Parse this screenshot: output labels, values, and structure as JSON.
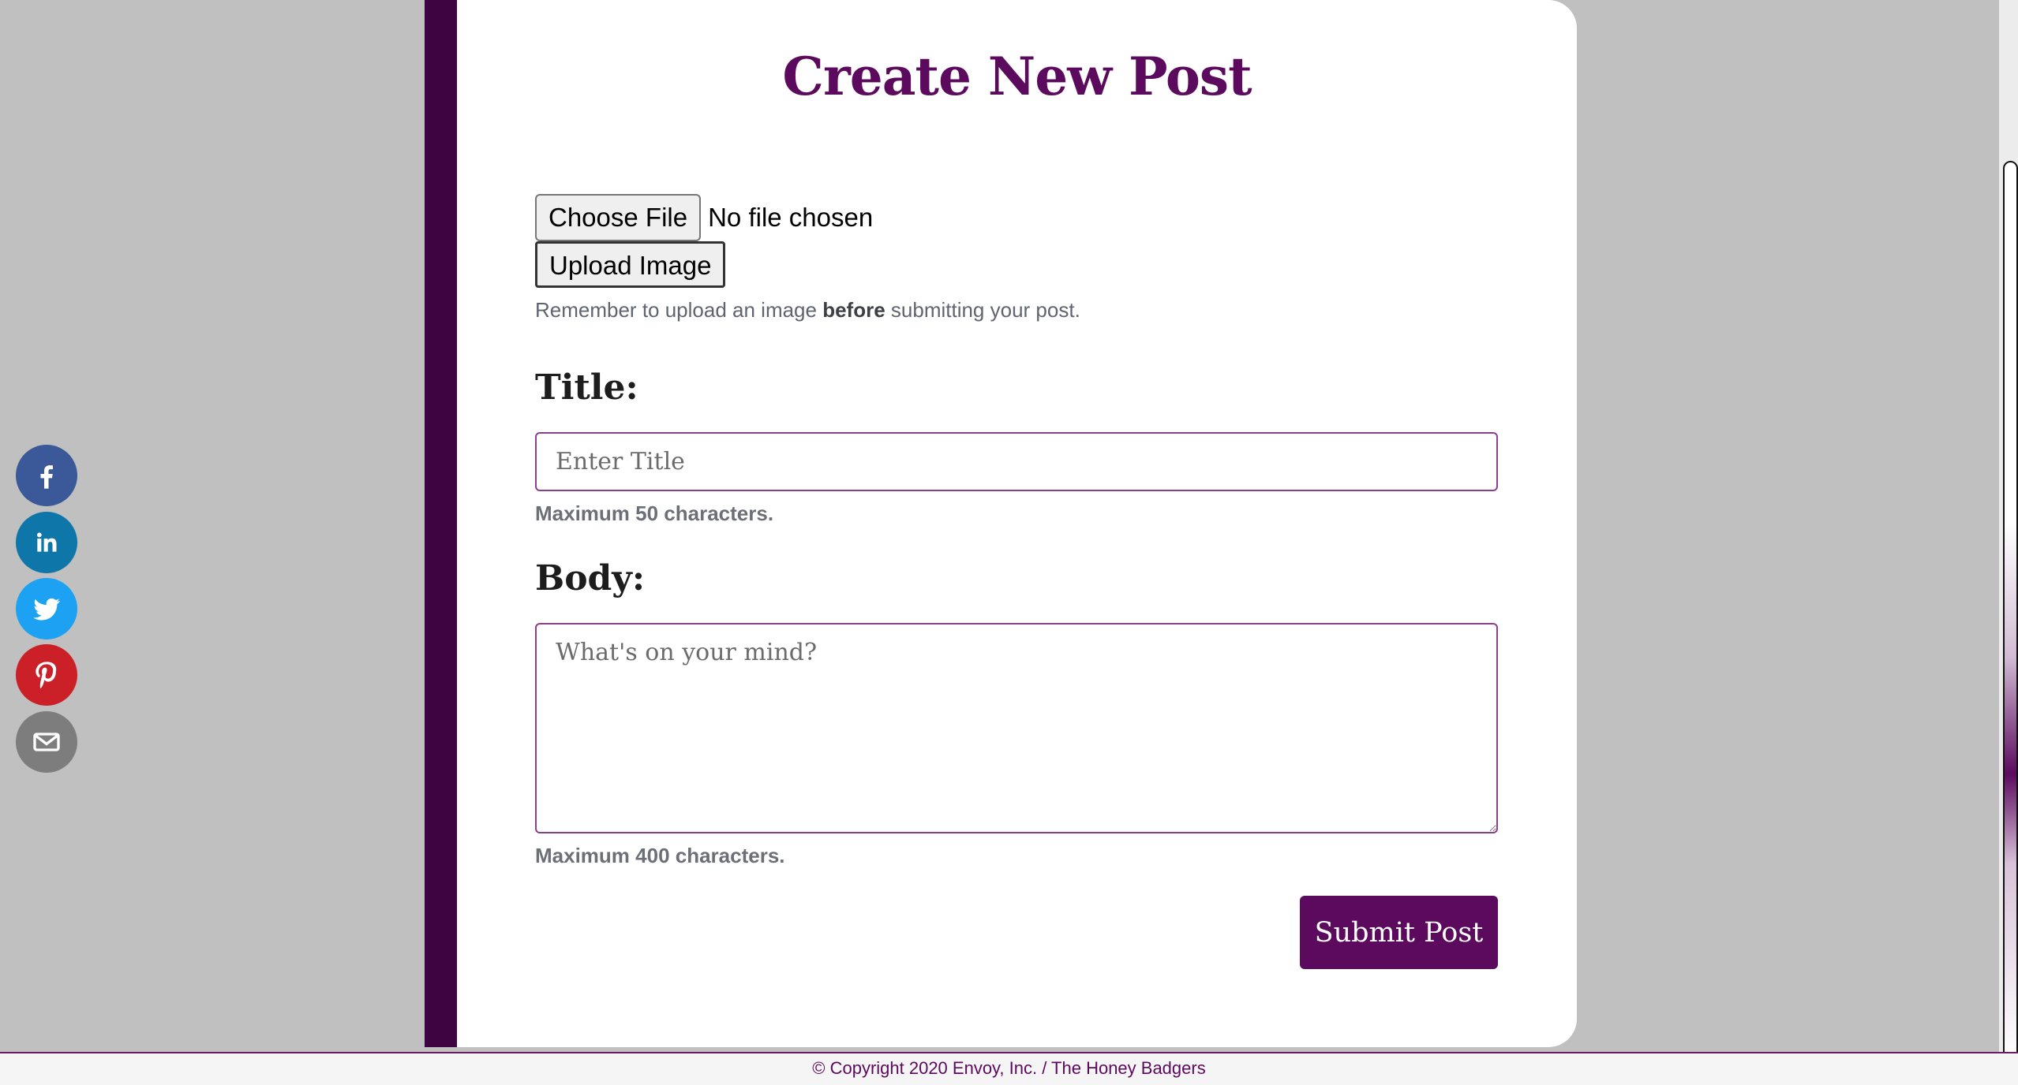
{
  "page": {
    "title": "Create New Post"
  },
  "upload": {
    "choose_label": "Choose File",
    "status": "No file chosen",
    "upload_label": "Upload Image",
    "hint_before": "Remember to upload an image ",
    "hint_bold": "before",
    "hint_after": " submitting your post."
  },
  "title_field": {
    "label": "Title:",
    "placeholder": "Enter Title",
    "value": "",
    "note": "Maximum 50 characters."
  },
  "body_field": {
    "label": "Body:",
    "placeholder": "What's on your mind?",
    "value": "",
    "note": "Maximum 400 characters."
  },
  "submit_label": "Submit Post",
  "footer": "© Copyright 2020 Envoy, Inc. / The Honey Badgers",
  "social": [
    {
      "icon": "facebook-icon",
      "color": "#3b5998"
    },
    {
      "icon": "linkedin-icon",
      "color": "#0e76a8"
    },
    {
      "icon": "twitter-icon",
      "color": "#1da1f2"
    },
    {
      "icon": "pinterest-icon",
      "color": "#cb2027"
    },
    {
      "icon": "email-icon",
      "color": "#7d7d7d"
    }
  ],
  "colors": {
    "brand": "#5c0a5e",
    "accent_stripe": "#3e0442",
    "background": "#c0c0c0"
  }
}
